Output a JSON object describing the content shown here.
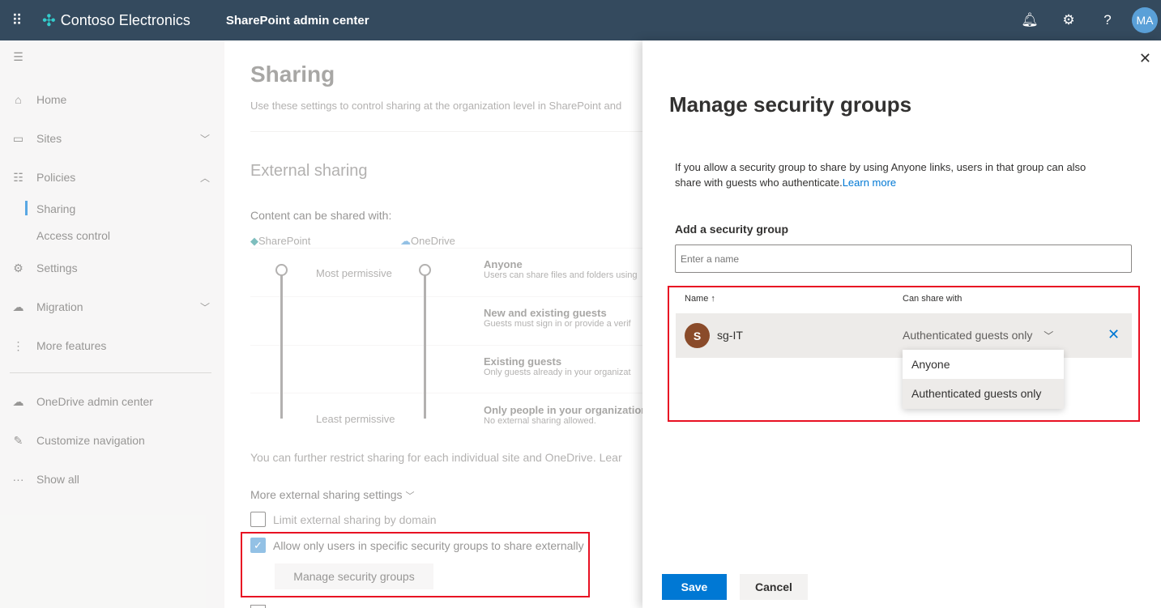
{
  "header": {
    "org": "Contoso Electronics",
    "app": "SharePoint admin center",
    "avatar": "MA",
    "icons": [
      "waffle-icon",
      "bell-icon",
      "gear-icon",
      "help-icon"
    ]
  },
  "nav": {
    "items": [
      {
        "label": "Home"
      },
      {
        "label": "Sites"
      },
      {
        "label": "Policies"
      },
      {
        "label": "Sharing"
      },
      {
        "label": "Access control"
      },
      {
        "label": "Settings"
      },
      {
        "label": "Migration"
      },
      {
        "label": "More features"
      },
      {
        "label": "OneDrive admin center"
      },
      {
        "label": "Customize navigation"
      },
      {
        "label": "Show all"
      }
    ]
  },
  "main": {
    "title": "Sharing",
    "description": "Use these settings to control sharing at the organization level in SharePoint and",
    "external_heading": "External sharing",
    "content_label": "Content can be shared with:",
    "sharepoint": "SharePoint",
    "onedrive": "OneDrive",
    "most": "Most permissive",
    "least": "Least permissive",
    "levels": [
      {
        "title": "Anyone",
        "desc": "Users can share files and folders using"
      },
      {
        "title": "New and existing guests",
        "desc": "Guests must sign in or provide a verif"
      },
      {
        "title": "Existing guests",
        "desc": "Only guests already in your organizat"
      },
      {
        "title": "Only people in your organization",
        "desc": "No external sharing allowed."
      }
    ],
    "restrict_note": "You can further restrict sharing for each individual site and OneDrive. Lear",
    "more_settings": "More external sharing settings",
    "limit_domain": "Limit external sharing by domain",
    "allow_groups": "Allow only users in specific security groups to share externally",
    "allow_groups_checked": true,
    "limit_domain_checked": false,
    "manage_button": "Manage security groups"
  },
  "panel": {
    "title": "Manage security groups",
    "info": "If you allow a security group to share by using Anyone links, users in that group can also",
    "info2": "share with guests who authenticate.",
    "learn_more": "Learn more",
    "add_label": "Add a security group",
    "input_placeholder": "Enter a name",
    "col_name": "Name",
    "sort": "↑",
    "col_share": "Can share with",
    "row": {
      "initial": "S",
      "name": "sg-IT",
      "share": "Authenticated guests only"
    },
    "dropdown": [
      "Anyone",
      "Authenticated guests only"
    ],
    "selected": "Authenticated guests only",
    "save": "Save",
    "cancel": "Cancel"
  },
  "colors": {
    "topbar": "#344a5e",
    "accent": "#0078d4",
    "highlight": "#e81123",
    "avatar_group": "#8a4b2a"
  }
}
